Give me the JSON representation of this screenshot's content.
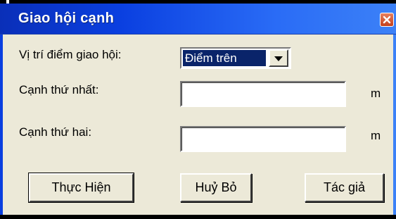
{
  "window": {
    "title": "Giao hội cạnh"
  },
  "form": {
    "position_label": "Vị trí điểm giao hội:",
    "position_selected": "Điểm trên",
    "side1_label": "Cạnh thứ nhất:",
    "side1_value": "",
    "side1_unit": "m",
    "side2_label": "Cạnh thứ hai:",
    "side2_value": "",
    "side2_unit": "m"
  },
  "buttons": {
    "execute": "Thực Hiện",
    "cancel": "Huỷ Bỏ",
    "author": "Tác giả"
  },
  "colors": {
    "titlebar_start": "#0a2fb8",
    "titlebar_end": "#3c81f7",
    "dialog_bg": "#ece9d8",
    "selection_bg": "#0a246a",
    "close_button": "#c4401c"
  },
  "icons": {
    "close": "close-icon",
    "dropdown": "chevron-down-icon"
  }
}
